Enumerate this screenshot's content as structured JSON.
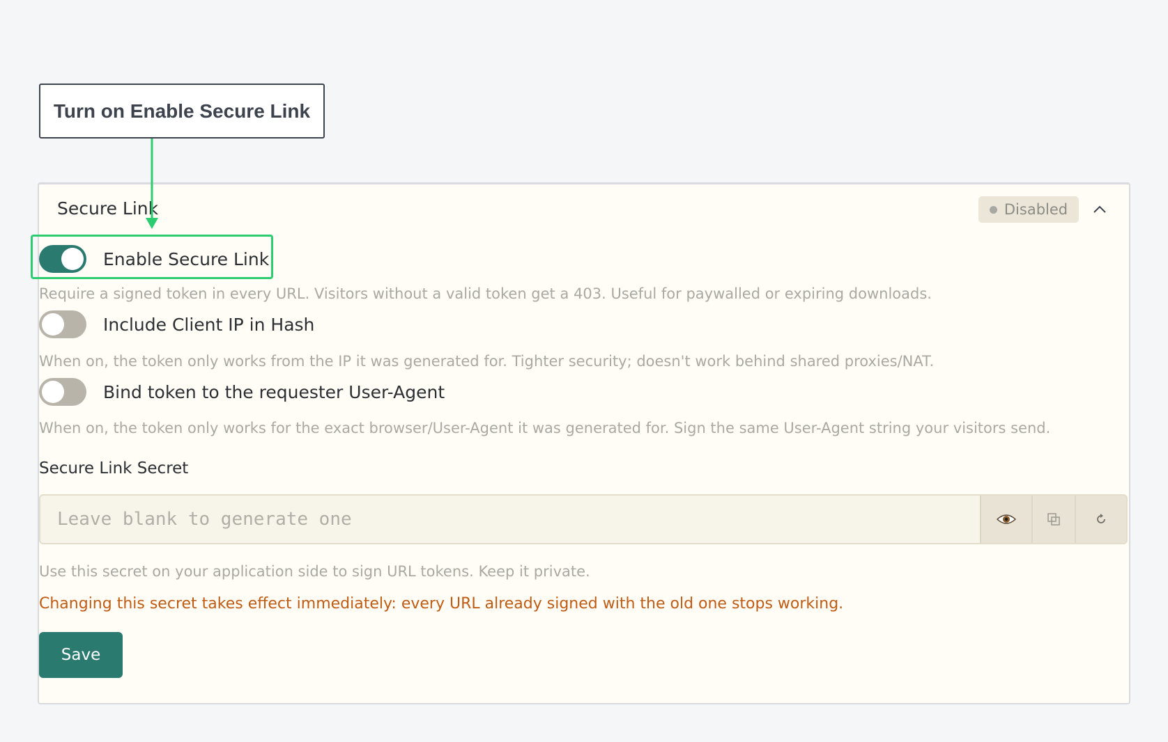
{
  "callout": {
    "text": "Turn on Enable Secure Link"
  },
  "panel": {
    "title": "Secure Link",
    "status": "Disabled",
    "collapse_icon": "chevron-up-icon"
  },
  "settings": {
    "enable": {
      "label": "Enable Secure Link",
      "state": "on",
      "help": "Require a signed token in every URL. Visitors without a valid token get a 403. Useful for paywalled or expiring downloads."
    },
    "client_ip": {
      "label": "Include Client IP in Hash",
      "state": "off",
      "help": "When on, the token only works from the IP it was generated for. Tighter security; doesn't work behind shared proxies/NAT."
    },
    "user_agent": {
      "label": "Bind token to the requester User-Agent",
      "state": "off",
      "help": "When on, the token only works for the exact browser/User-Agent it was generated for. Sign the same User-Agent string your visitors send."
    }
  },
  "secret": {
    "label": "Secure Link Secret",
    "placeholder": "Leave blank to generate one",
    "value": "",
    "buttons": [
      "eye-icon",
      "copy-icon",
      "refresh-icon"
    ],
    "help": "Use this secret on your application side to sign URL tokens. Keep it private.",
    "warning": "Changing this secret takes effect immediately: every URL already signed with the old one stops working."
  },
  "actions": {
    "save_label": "Save"
  },
  "colors": {
    "accent": "#2a7a70",
    "highlight": "#2ecc71",
    "warning": "#bf5b12",
    "background": "#f5f6f8",
    "panel_bg": "#fffdf6"
  }
}
